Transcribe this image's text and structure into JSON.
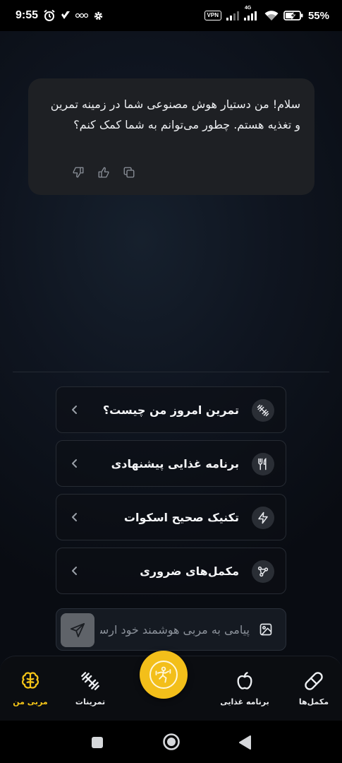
{
  "status_bar": {
    "time": "9:55",
    "vpn": "VPN",
    "network": "4G",
    "battery": "55%"
  },
  "chat": {
    "assistant_message": "سلام! من دستیار هوش مصنوعی شما در زمینه تمرین و تغذیه هستم. چطور می‌توانم به شما کمک کنم؟"
  },
  "suggestions": [
    {
      "label": "تمرین امروز من چیست؟",
      "icon": "dumbbell-icon"
    },
    {
      "label": "برنامه غذایی پیشنهادی",
      "icon": "utensils-icon"
    },
    {
      "label": "تکنیک صحیح اسکوات",
      "icon": "lightning-icon"
    },
    {
      "label": "مکمل‌های ضروری",
      "icon": "molecule-icon"
    }
  ],
  "input": {
    "placeholder": "پیامی به مربی هوشمند خود ارسال کنید...",
    "value": ""
  },
  "bottom_nav": {
    "items": [
      {
        "label": "مربی من",
        "icon": "brain-icon",
        "active": true
      },
      {
        "label": "تمرینات",
        "icon": "dumbbell-icon",
        "active": false
      },
      {
        "label": "برنامه غذایی",
        "icon": "apple-icon",
        "active": false
      },
      {
        "label": "مکمل‌ها",
        "icon": "pill-icon",
        "active": false
      }
    ]
  },
  "colors": {
    "accent": "#f5c518",
    "bubble": "#1e2024",
    "background": "#0f1520"
  }
}
